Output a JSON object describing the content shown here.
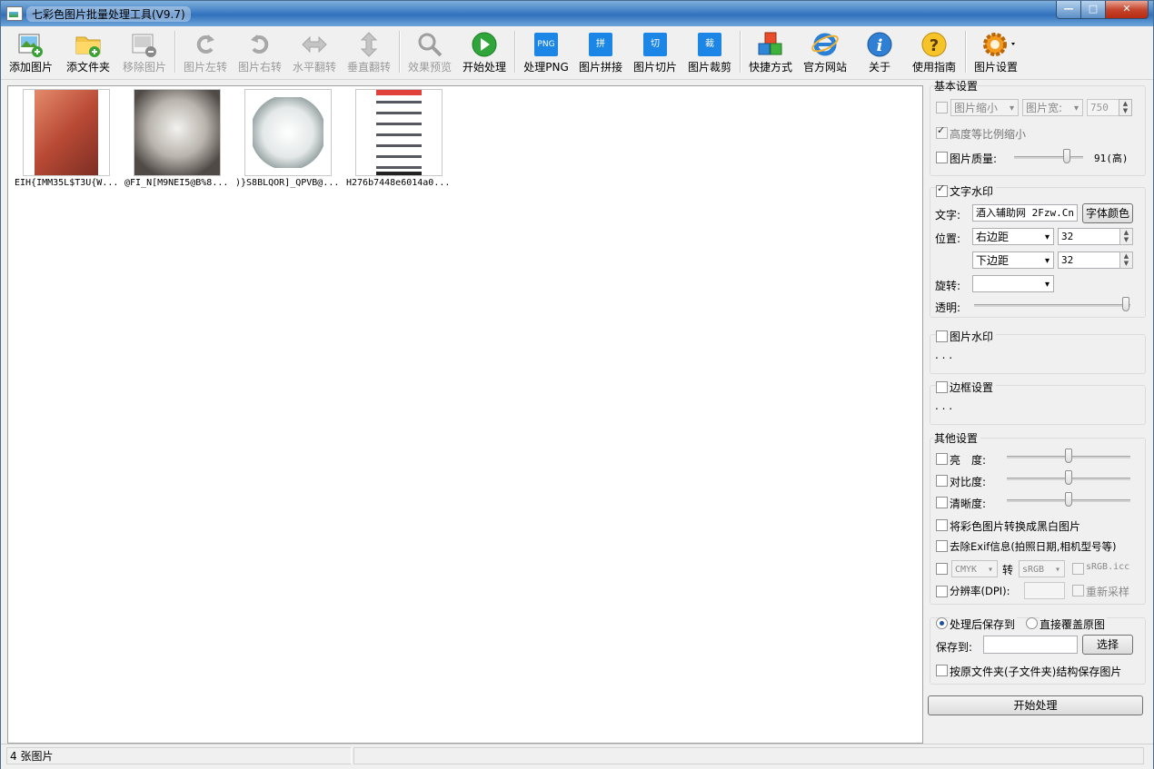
{
  "window": {
    "title": "七彩色图片批量处理工具(V9.7)"
  },
  "toolbar": {
    "add_image": "添加图片",
    "add_folder": "添文件夹",
    "remove_image": "移除图片",
    "rotate_left": "图片左转",
    "rotate_right": "图片右转",
    "flip_h": "水平翻转",
    "flip_v": "垂直翻转",
    "preview": "效果预览",
    "start": "开始处理",
    "png_icon": "PNG",
    "process_png": "处理PNG",
    "stitch_icon": "拼",
    "stitch": "图片拼接",
    "slice_icon": "切",
    "slice": "图片切片",
    "crop_icon": "裁",
    "crop": "图片裁剪",
    "shortcut": "快捷方式",
    "website": "官方网站",
    "about": "关于",
    "guide": "使用指南",
    "settings": "图片设置"
  },
  "images": [
    {
      "name": "EIH{IMM35L$T3U{W...",
      "color": "#c0614a"
    },
    {
      "name": "@FI_N[M9NEI5@B%8...",
      "color": "#b9b4ad"
    },
    {
      "name": ")}S8BLQOR]_QPVB@...",
      "color": "#e9ecec"
    },
    {
      "name": "H276b7448e6014a0...",
      "color": "#ffffff"
    }
  ],
  "basic": {
    "title": "基本设置",
    "shrink_combo": "图片缩小",
    "width_combo": "图片宽:",
    "width_value": "750",
    "keep_ratio": "高度等比例缩小",
    "quality_label": "图片质量:",
    "quality_value": "91(高)",
    "quality_level": 0.8
  },
  "text_watermark": {
    "title": "文字水印",
    "text_label": "文字:",
    "text_value": "酒入辅助网 2Fzw.Cn",
    "font_color_btn": "字体颜色",
    "pos_label": "位置:",
    "h_combo": "右边距",
    "h_value": "32",
    "v_combo": "下边距",
    "v_value": "32",
    "rotate_label": "旋转:",
    "rotate_combo": "",
    "opacity_label": "透明:",
    "opacity_level": 1.0
  },
  "image_watermark": {
    "title": "图片水印",
    "dots": ". . ."
  },
  "border": {
    "title": "边框设置",
    "dots": ". . ."
  },
  "other": {
    "title": "其他设置",
    "brightness": "亮　度:",
    "contrast": "对比度:",
    "sharpness": "清晰度:",
    "grayscale": "将彩色图片转换成黑白图片",
    "exif": "去除Exif信息(拍照日期,相机型号等)",
    "cmyk_combo": "CMYK",
    "convert_label": "转",
    "srgb_combo": "sRGB",
    "srgb_icc": "sRGB.icc",
    "dpi_label": "分辨率(DPI):",
    "resample": "重新采样"
  },
  "save": {
    "save_to_radio": "处理后保存到",
    "overwrite_radio": "直接覆盖原图",
    "save_to_label": "保存到:",
    "choose_btn": "选择",
    "keep_structure": "按原文件夹(子文件夹)结构保存图片",
    "start_btn": "开始处理"
  },
  "status": {
    "count": "4 张图片"
  }
}
